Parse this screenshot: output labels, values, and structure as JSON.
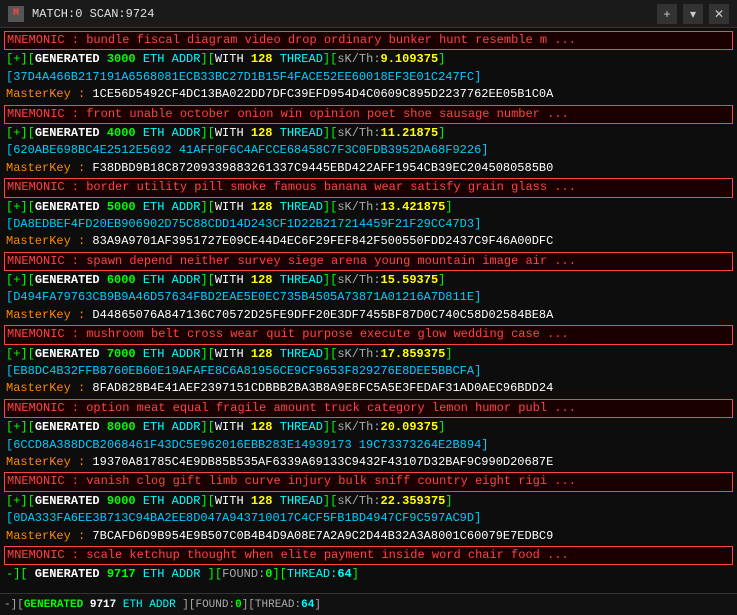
{
  "titlebar": {
    "icon": "M",
    "title": "MATCH:0 SCAN:9724",
    "plus_label": "+",
    "dropdown_label": "▾",
    "close_label": "✕"
  },
  "statusbar": {
    "generated_label": "-][",
    "generated_text": "GENERATED",
    "generated_num": "9717",
    "eth_label": "ETH ADDR",
    "found_label": "][FOUND:",
    "found_num": "0",
    "thread_label": "][THREAD:",
    "thread_num": "64"
  },
  "lines": [
    {
      "type": "mnemonic",
      "text": "MNEMONIC : bundle fiscal diagram video drop ordinary bunker hunt resemble m ..."
    },
    {
      "type": "generated",
      "num": "3000",
      "sk": "9.109375"
    },
    {
      "type": "addr",
      "text": "37D4A466B217191A6568081ECB33BC27D1B15F4FACE52EE60018EF3E01C247FC"
    },
    {
      "type": "masterkey",
      "label": "MasterKey :",
      "text": "1CE56D5492CF4DC13BA022DD7DFC39EFD954D4C0609C895D2237762EE05B1C0A"
    },
    {
      "type": "mnemonic",
      "text": "MNEMONIC : front unable october onion win opinion poet shoe sausage number ..."
    },
    {
      "type": "generated",
      "num": "4000",
      "sk": "11.21875"
    },
    {
      "type": "addr",
      "text": "620ABE698BC4E2512E5692 41AFF0F6C4AFCCE68458C7F3C0FDB3952DA68F9226"
    },
    {
      "type": "masterkey",
      "label": "MasterKey :",
      "text": "F38DBD9B18C87209339883261337C9445EBD422AFF1954CB39EC2045080585B0"
    },
    {
      "type": "mnemonic",
      "text": "MNEMONIC : border utility pill smoke famous banana wear satisfy grain glass ..."
    },
    {
      "type": "generated",
      "num": "5000",
      "sk": "13.421875"
    },
    {
      "type": "addr",
      "text": "DA8EDBEF4FD20EB906902D75C88CDD14D243CF1D22B217214459F21F29CC47D3"
    },
    {
      "type": "masterkey",
      "label": "MasterKey :",
      "text": "83A9A9701AF3951727E09CE44D4EC6F29FEF842F500550FDD2437C9F46A00DFC"
    },
    {
      "type": "mnemonic",
      "text": "MNEMONIC : spawn depend neither survey siege arena young mountain image air ..."
    },
    {
      "type": "generated",
      "num": "6000",
      "sk": "15.59375"
    },
    {
      "type": "addr",
      "text": "D494FA79763CB9B9A46D57634FBD2EAE5E0EC735B4505A73871A01216A7D811E"
    },
    {
      "type": "masterkey",
      "label": "MasterKey :",
      "text": "D44865076A847136C70572D25FE9DFF20E3DF7455BF87D0C740C58D02584BE8A"
    },
    {
      "type": "mnemonic",
      "text": "MNEMONIC : mushroom belt cross wear quit purpose execute glow wedding case ..."
    },
    {
      "type": "generated",
      "num": "7000",
      "sk": "17.859375"
    },
    {
      "type": "addr",
      "text": "EB8DC4B32FFB8760EB60E19AFAFE8C6A81956CE9CF9653F829276E8DEE5BBCFA"
    },
    {
      "type": "masterkey",
      "label": "MasterKey :",
      "text": "8FAD828B4E41AEF2397151CDBBB2BA3B8A9E8FC5A5E3FEDAF31AD0AEC96BDD24"
    },
    {
      "type": "mnemonic",
      "text": "MNEMONIC : option meat equal fragile amount truck category lemon humor publ ..."
    },
    {
      "type": "generated",
      "num": "8000",
      "sk": "20.09375"
    },
    {
      "type": "addr",
      "text": "6CCD8A388DCB2068461F43DC5E962016EBB283E14939173 19C73373264E2B894"
    },
    {
      "type": "masterkey",
      "label": "MasterKey :",
      "text": "19370A81785C4E9DB85B535AF6339A69133C9432F43107D32BAF9C990D20687E"
    },
    {
      "type": "mnemonic",
      "text": "MNEMONIC : vanish clog gift limb curve injury bulk sniff country eight rigi ..."
    },
    {
      "type": "generated",
      "num": "9000",
      "sk": "22.359375"
    },
    {
      "type": "addr",
      "text": "0DA333FA6EE3B713C94BA2EE8D047A943710017C4CF5FB1BD4947CF9C597AC9D"
    },
    {
      "type": "masterkey",
      "label": "MasterKey :",
      "text": "7BCAFD6D9B954E9B507C0B4B4D9A08E7A2A9C2D44B32A3A8001C60079E7EDBC9"
    },
    {
      "type": "mnemonic",
      "text": "MNEMONIC : scale ketchup thought when elite payment inside word chair food ..."
    }
  ]
}
